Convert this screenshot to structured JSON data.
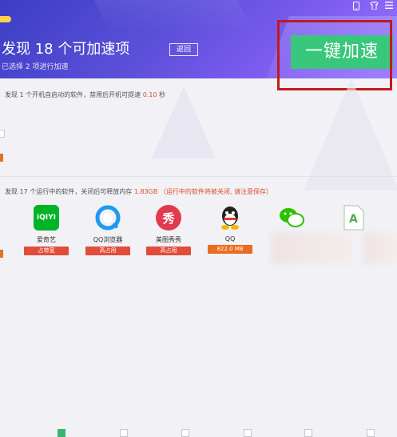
{
  "header": {
    "title": "发现 18 个可加速项",
    "back_label": "返回",
    "subtitle": "已选择 2 项进行加速",
    "accelerate_label": "一键加速",
    "window_icons": [
      "phone-icon",
      "shirt-icon",
      "menu-icon",
      "minimize-icon"
    ]
  },
  "sections": {
    "startup": {
      "prefix": "发现 1 个开机自启动的软件，禁用后开机可提速",
      "value": "0.10",
      "suffix": "秒"
    },
    "running": {
      "prefix": "发现 17 个运行中的软件，关闭后可释放内存",
      "value": "1.83GB",
      "note": "（运行中的软件将被关闭, 请注意保存）"
    }
  },
  "apps": [
    {
      "label": "爱奇艺",
      "tag": "占带宽",
      "icon": "iqiyi-icon",
      "color": "#00b327"
    },
    {
      "label": "QQ浏览器",
      "tag": "高占用",
      "icon": "qqbrowser-icon",
      "color": "#1e9bf0"
    },
    {
      "label": "美图秀秀",
      "tag": "高占用",
      "icon": "meitu-icon",
      "color": "#e23a4d"
    },
    {
      "label": "QQ",
      "tag": "822.0 MB",
      "icon": "qq-icon",
      "color": "#222222"
    },
    {
      "label": "",
      "tag": "",
      "icon": "wechat-icon",
      "color": "#2dc100"
    },
    {
      "label": "",
      "tag": "",
      "icon": "doc-icon",
      "color": "#4caf50"
    }
  ],
  "icons": {
    "iqiyi_text": "iQIYI",
    "meitu_glyph": "秀"
  }
}
